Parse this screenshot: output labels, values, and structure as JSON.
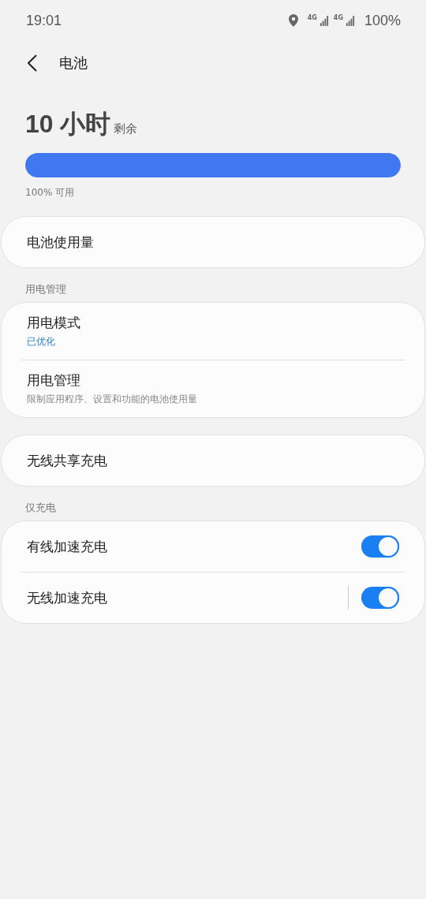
{
  "status_bar": {
    "time": "19:01",
    "networks": [
      "4G",
      "4G"
    ],
    "battery": "100%"
  },
  "header": {
    "title": "电池"
  },
  "battery": {
    "remaining": "10 小时",
    "suffix": "剩余",
    "level": 1,
    "caption": "100% 可用"
  },
  "groups": [
    {
      "items": [
        {
          "kind": "link",
          "title": "电池使用量"
        }
      ]
    },
    {
      "section": "用电管理",
      "items": [
        {
          "kind": "status",
          "title": "用电模式",
          "subtitle": "已优化"
        },
        {
          "kind": "description",
          "title": "用电管理",
          "subtitle": "限制应用程序、设置和功能的电池使用量"
        }
      ]
    },
    {
      "items": [
        {
          "kind": "link",
          "title": "无线共享充电"
        }
      ]
    },
    {
      "section": "仅充电",
      "items": [
        {
          "kind": "switch",
          "title": "有线加速充电",
          "on": true,
          "split": false
        },
        {
          "kind": "switch",
          "title": "无线加速充电",
          "on": true,
          "split": true
        }
      ]
    }
  ]
}
